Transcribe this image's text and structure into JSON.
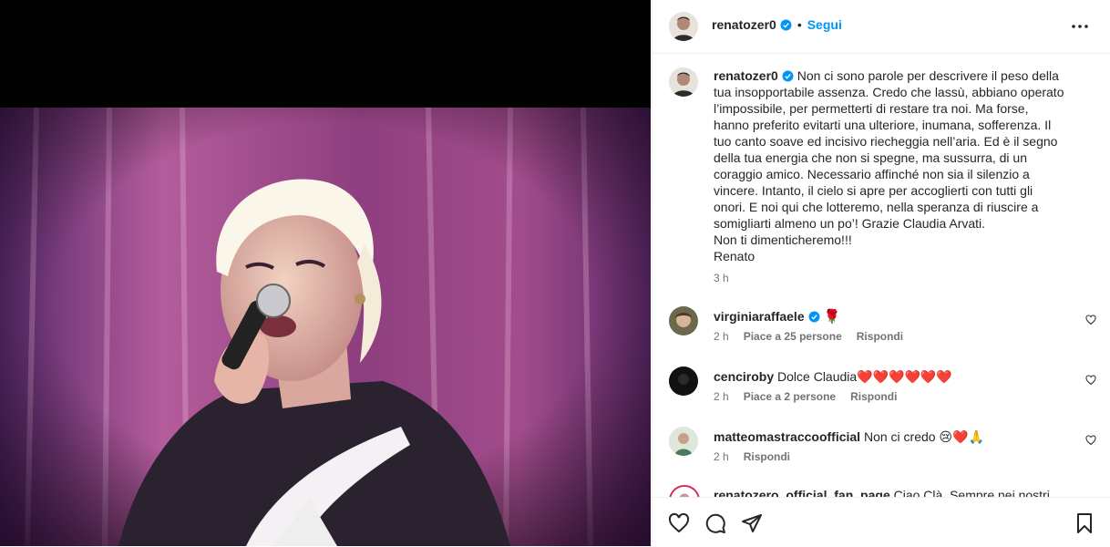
{
  "post": {
    "author": "renatozer0",
    "follow_label": "Segui",
    "separator": "•",
    "caption": "Non ci sono parole per descrivere il peso della tua insopportabile assenza. Credo che lassù, abbiano operato l’impossibile, per permetterti di restare tra noi. Ma forse, hanno preferito evitarti una ulteriore, inumana, sofferenza. Il tuo canto soave ed incisivo riecheggia nell’aria. Ed è il segno della tua energia che non si spegne, ma sussurra, di un coraggio amico. Necessario affinché non sia il silenzio a vincere. Intanto, il cielo si apre per accoglierti con tutti gli onori. E noi qui che lotteremo, nella speranza di riuscire a somigliarti almeno un po’! Grazie Claudia Arvati.\nNon ti dimenticheremo!!!\nRenato",
    "time": "3 h"
  },
  "comments": [
    {
      "user": "virginiaraffaele",
      "verified": true,
      "text": "🌹",
      "time": "2 h",
      "likes": "Piace a 25 persone",
      "reply": "Rispondi"
    },
    {
      "user": "cenciroby",
      "verified": false,
      "text": "Dolce Claudia❤️❤️❤️❤️❤️❤️",
      "time": "2 h",
      "likes": "Piace a 2 persone",
      "reply": "Rispondi"
    },
    {
      "user": "matteomastraccoofficial",
      "verified": false,
      "text": "Non ci credo 😢❤️🙏",
      "time": "2 h",
      "likes": "",
      "reply": "Rispondi"
    },
    {
      "user": "renatozero_official_fan_page",
      "verified": false,
      "text": "Ciao Clà. Sempre nei nostri",
      "time": "",
      "likes": "",
      "reply": ""
    }
  ],
  "icons": {
    "like": "heart-icon",
    "comment": "comment-bubble-icon",
    "share": "paper-plane-icon",
    "save": "bookmark-icon",
    "more": "more-options-icon",
    "verified": "verified-badge-icon"
  },
  "colors": {
    "accent": "#0095f6",
    "verified": "#0095f6",
    "text": "#262626",
    "muted": "#737373",
    "stage_backdrop": "#9b3d80"
  }
}
